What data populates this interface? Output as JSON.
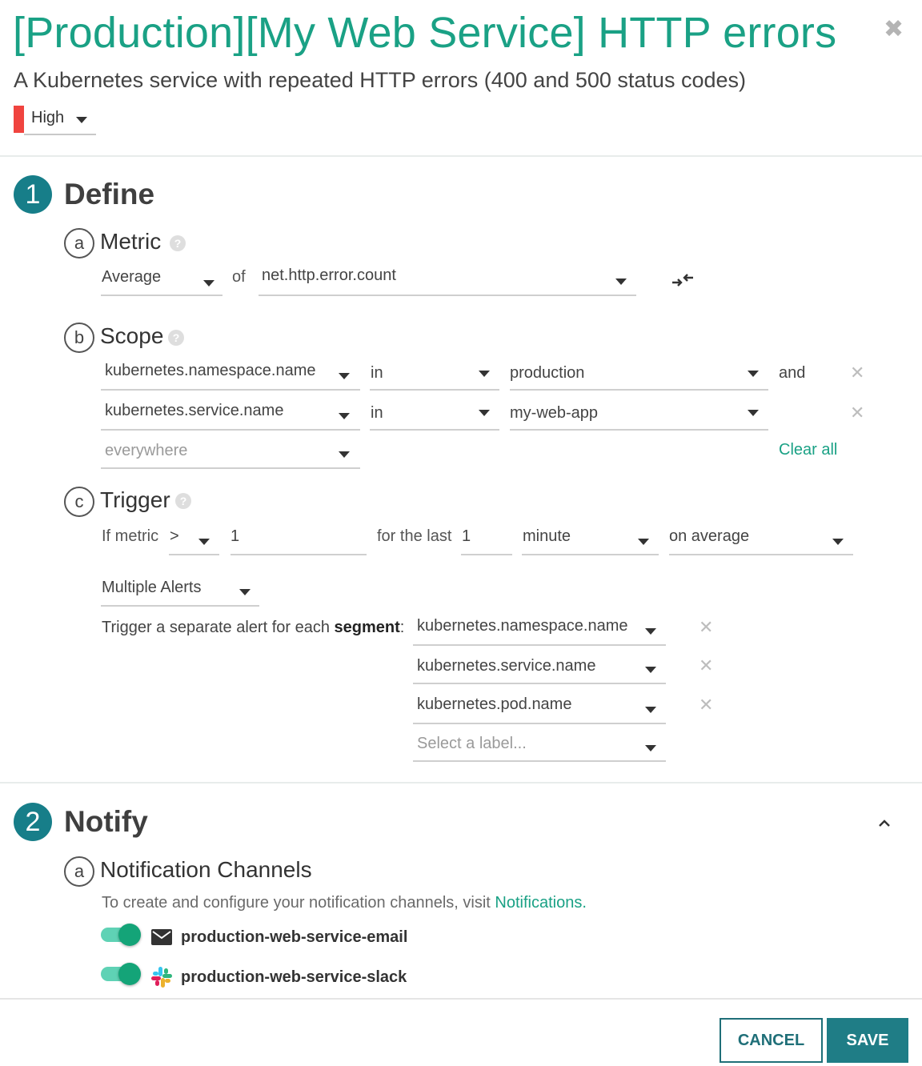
{
  "header": {
    "title": "[Production][My Web Service] HTTP errors",
    "subtitle": "A Kubernetes service with repeated HTTP errors (400 and 500 status codes)",
    "severity": "High",
    "severity_color": "#f0443f",
    "close_icon": "close-icon"
  },
  "define": {
    "step_number": "1",
    "title": "Define",
    "metric": {
      "letter": "a",
      "title": "Metric",
      "aggregation": "Average",
      "of_label": "of",
      "metric_name": "net.http.error.count",
      "swap_icon": "swap-arrows-icon"
    },
    "scope": {
      "letter": "b",
      "title": "Scope",
      "rows": [
        {
          "label": "kubernetes.namespace.name",
          "operator": "in",
          "value": "production",
          "conjunction": "and"
        },
        {
          "label": "kubernetes.service.name",
          "operator": "in",
          "value": "my-web-app",
          "conjunction": ""
        }
      ],
      "add_placeholder": "everywhere",
      "clear_all": "Clear all"
    },
    "trigger": {
      "letter": "c",
      "title": "Trigger",
      "if_metric_label": "If metric",
      "comparator": ">",
      "threshold": "1",
      "for_the_last_label": "for the last",
      "duration": "1",
      "unit": "minute",
      "aggregation": "on average",
      "alert_mode": "Multiple Alerts",
      "segment_text_prefix": "Trigger a separate alert for each",
      "segment_text_bold": "segment",
      "segment_text_suffix": ":",
      "segments": [
        "kubernetes.namespace.name",
        "kubernetes.service.name",
        "kubernetes.pod.name"
      ],
      "segment_placeholder": "Select a label..."
    }
  },
  "notify": {
    "step_number": "2",
    "title": "Notify",
    "collapse_icon": "chevron-up-icon",
    "channels": {
      "letter": "a",
      "title": "Notification Channels",
      "help_text": "To create and configure your notification channels, visit",
      "help_link": "Notifications",
      "help_suffix": ".",
      "items": [
        {
          "name": "production-web-service-email",
          "icon": "email-icon",
          "enabled": true
        },
        {
          "name": "production-web-service-slack",
          "icon": "slack-icon",
          "enabled": true
        }
      ]
    }
  },
  "footer": {
    "cancel_label": "CANCEL",
    "save_label": "SAVE"
  }
}
